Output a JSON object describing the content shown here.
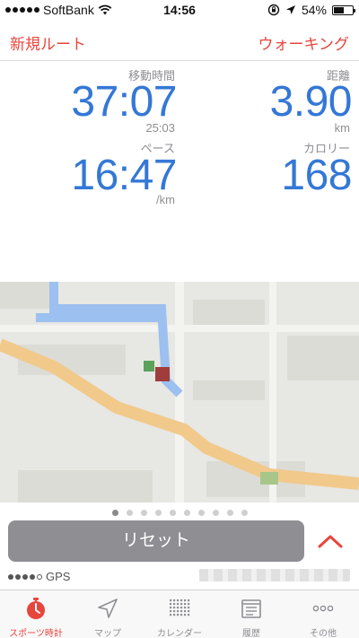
{
  "status_bar": {
    "carrier": "SoftBank",
    "time": "14:56",
    "battery": "54%",
    "battery_level": 0.54
  },
  "nav": {
    "left_label": "新規ルート",
    "right_label": "ウォーキング"
  },
  "stats": {
    "moving_time": {
      "label": "移動時間",
      "value": "37:07",
      "sub": "25:03"
    },
    "distance": {
      "label": "距離",
      "value": "3.90",
      "unit": "km"
    },
    "pace": {
      "label": "ペース",
      "value": "16:47",
      "unit": "/km"
    },
    "calories": {
      "label": "カロリー",
      "value": "168"
    }
  },
  "pager": {
    "count": 10,
    "active_index": 0
  },
  "controls": {
    "reset_label": "リセット"
  },
  "gps": {
    "label": "GPS",
    "strength": 4,
    "max": 5
  },
  "tabs": [
    {
      "label": "スポーツ時計",
      "icon": "stopwatch-icon",
      "active": true
    },
    {
      "label": "マップ",
      "icon": "location-arrow-icon",
      "active": false
    },
    {
      "label": "カレンダー",
      "icon": "calendar-grid-icon",
      "active": false
    },
    {
      "label": "履歴",
      "icon": "history-list-icon",
      "active": false
    },
    {
      "label": "その他",
      "icon": "more-dots-icon",
      "active": false
    }
  ],
  "colors": {
    "accent": "#e8453c",
    "value_blue": "#3478d6",
    "label_gray": "#8e8e93",
    "reset_button": "#8e8e93"
  }
}
